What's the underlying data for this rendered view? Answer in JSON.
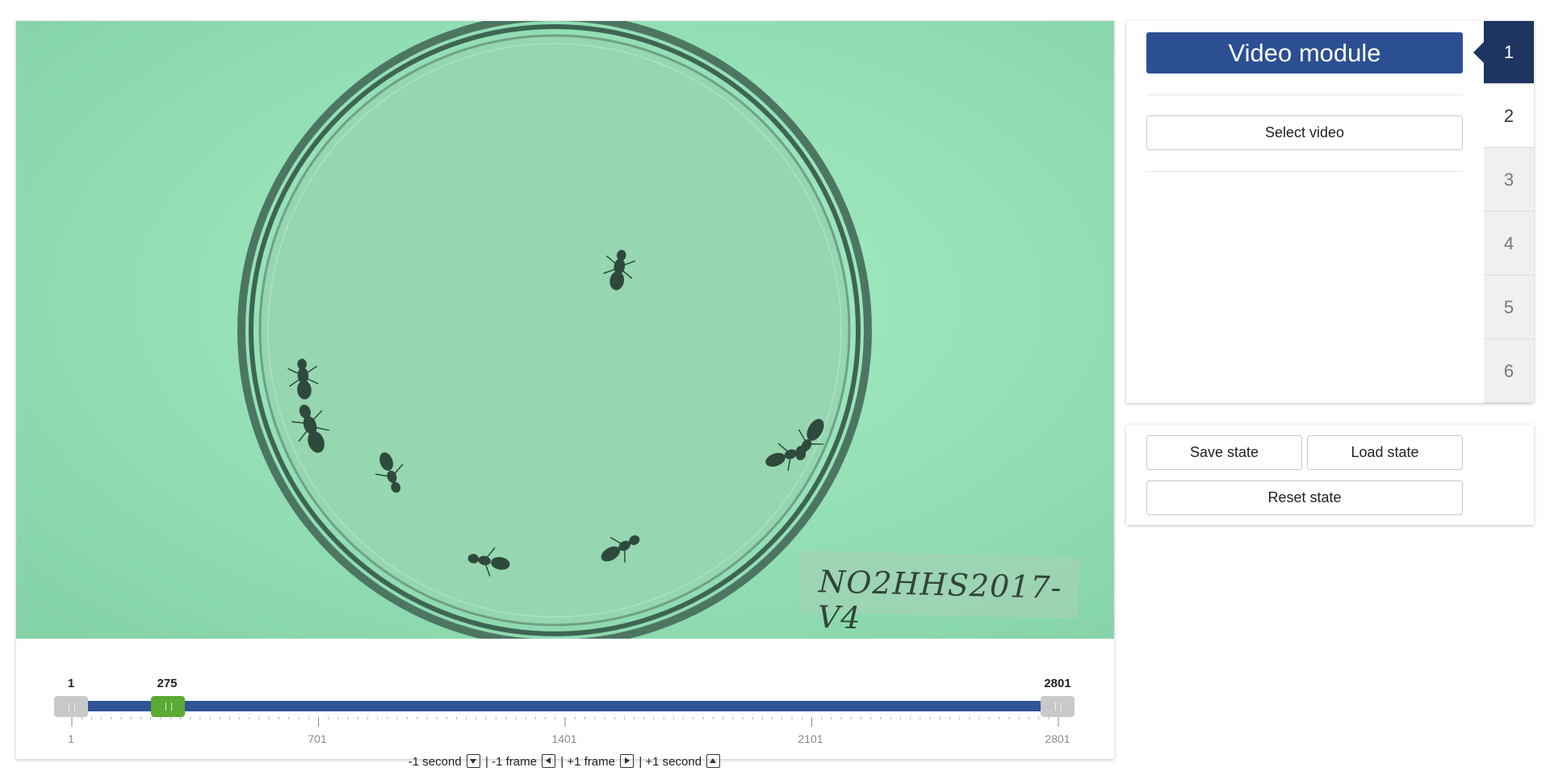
{
  "video": {
    "plate_label": "NO2HHS2017-V4",
    "slider": {
      "min": 1,
      "max": 2801,
      "current": 275,
      "min_label": "1",
      "current_label": "275",
      "max_label": "2801",
      "tick_labels": [
        "1",
        "701",
        "1401",
        "2101",
        "2801"
      ]
    },
    "nav": {
      "minus_second": "-1 second",
      "minus_frame": "-1 frame",
      "plus_frame": "+1 frame",
      "plus_second": "+1 second",
      "separator": "|"
    }
  },
  "module": {
    "title": "Video module",
    "select_video_label": "Select video",
    "steps": [
      "1",
      "2",
      "3",
      "4",
      "5",
      "6"
    ],
    "active_step": "1"
  },
  "state": {
    "save_label": "Save state",
    "load_label": "Load state",
    "reset_label": "Reset state"
  },
  "colors": {
    "primary": "#2c4f93",
    "active_step": "#1e3561",
    "handle_current": "#5aaa33",
    "track": "#2f5596"
  }
}
